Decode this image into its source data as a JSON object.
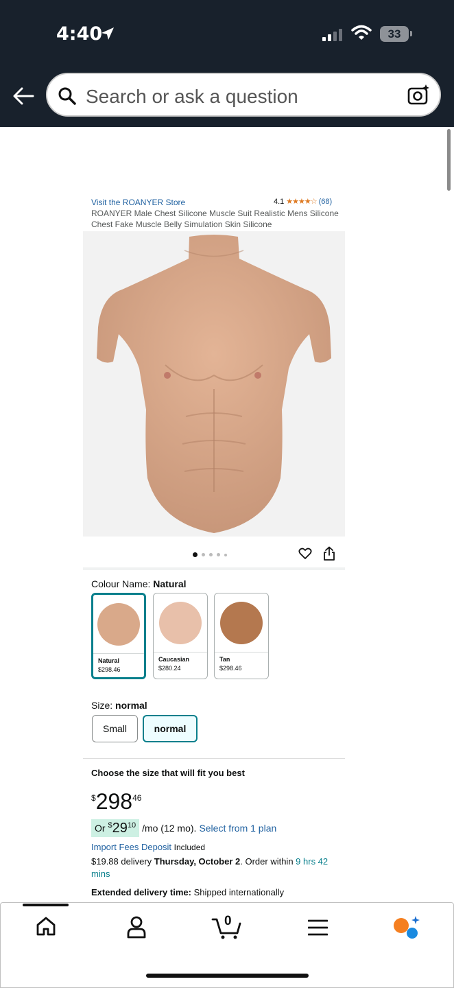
{
  "status_bar": {
    "time": "4:40",
    "battery": "33"
  },
  "search": {
    "placeholder": "Search or ask a question"
  },
  "product": {
    "store_link": "Visit the ROANYER Store",
    "rating_value": "4.1",
    "rating_stars": "★★★★☆",
    "rating_count": "(68)",
    "title": "ROANYER Male Chest Silicone Muscle Suit Realistic Mens Silicone Chest Fake Muscle Belly Simulation Skin Silicone",
    "image_dots_count": 5,
    "image_dots_active": 1
  },
  "colour": {
    "label": "Colour Name: ",
    "selected": "Natural",
    "options": [
      {
        "name": "Natural",
        "price": "$298.46",
        "color": "#d9a98a"
      },
      {
        "name": "Caucasian",
        "price": "$280.24",
        "color": "#e8c0aa"
      },
      {
        "name": "Tan",
        "price": "$298.46",
        "color": "#b4784f"
      }
    ]
  },
  "size": {
    "label": "Size: ",
    "selected": "normal",
    "options": [
      "Small",
      "normal"
    ]
  },
  "buybox": {
    "choose_size": "Choose the size that will fit you best",
    "price_currency": "$",
    "price_whole": "298",
    "price_fraction": "46",
    "monthly_prefix": "Or ",
    "monthly_currency": "$",
    "monthly_whole": "29",
    "monthly_fraction": "10",
    "monthly_suffix": "/mo (12 mo).",
    "monthly_plan": "Select from 1 plan",
    "import_fees_link": "Import Fees Deposit",
    "import_fees_status": "Included",
    "delivery_prefix": "$19.88 delivery ",
    "delivery_date": "Thursday, October 2",
    "delivery_mid": ". Order within ",
    "delivery_countdown": "9 hrs 42 mins",
    "extended_label": "Extended delivery time:",
    "extended_text": " Shipped internationally"
  },
  "nav": {
    "icons": [
      "home-icon",
      "account-icon",
      "cart-icon",
      "menu-icon",
      "rufus-icon"
    ],
    "cart_count": "0"
  }
}
